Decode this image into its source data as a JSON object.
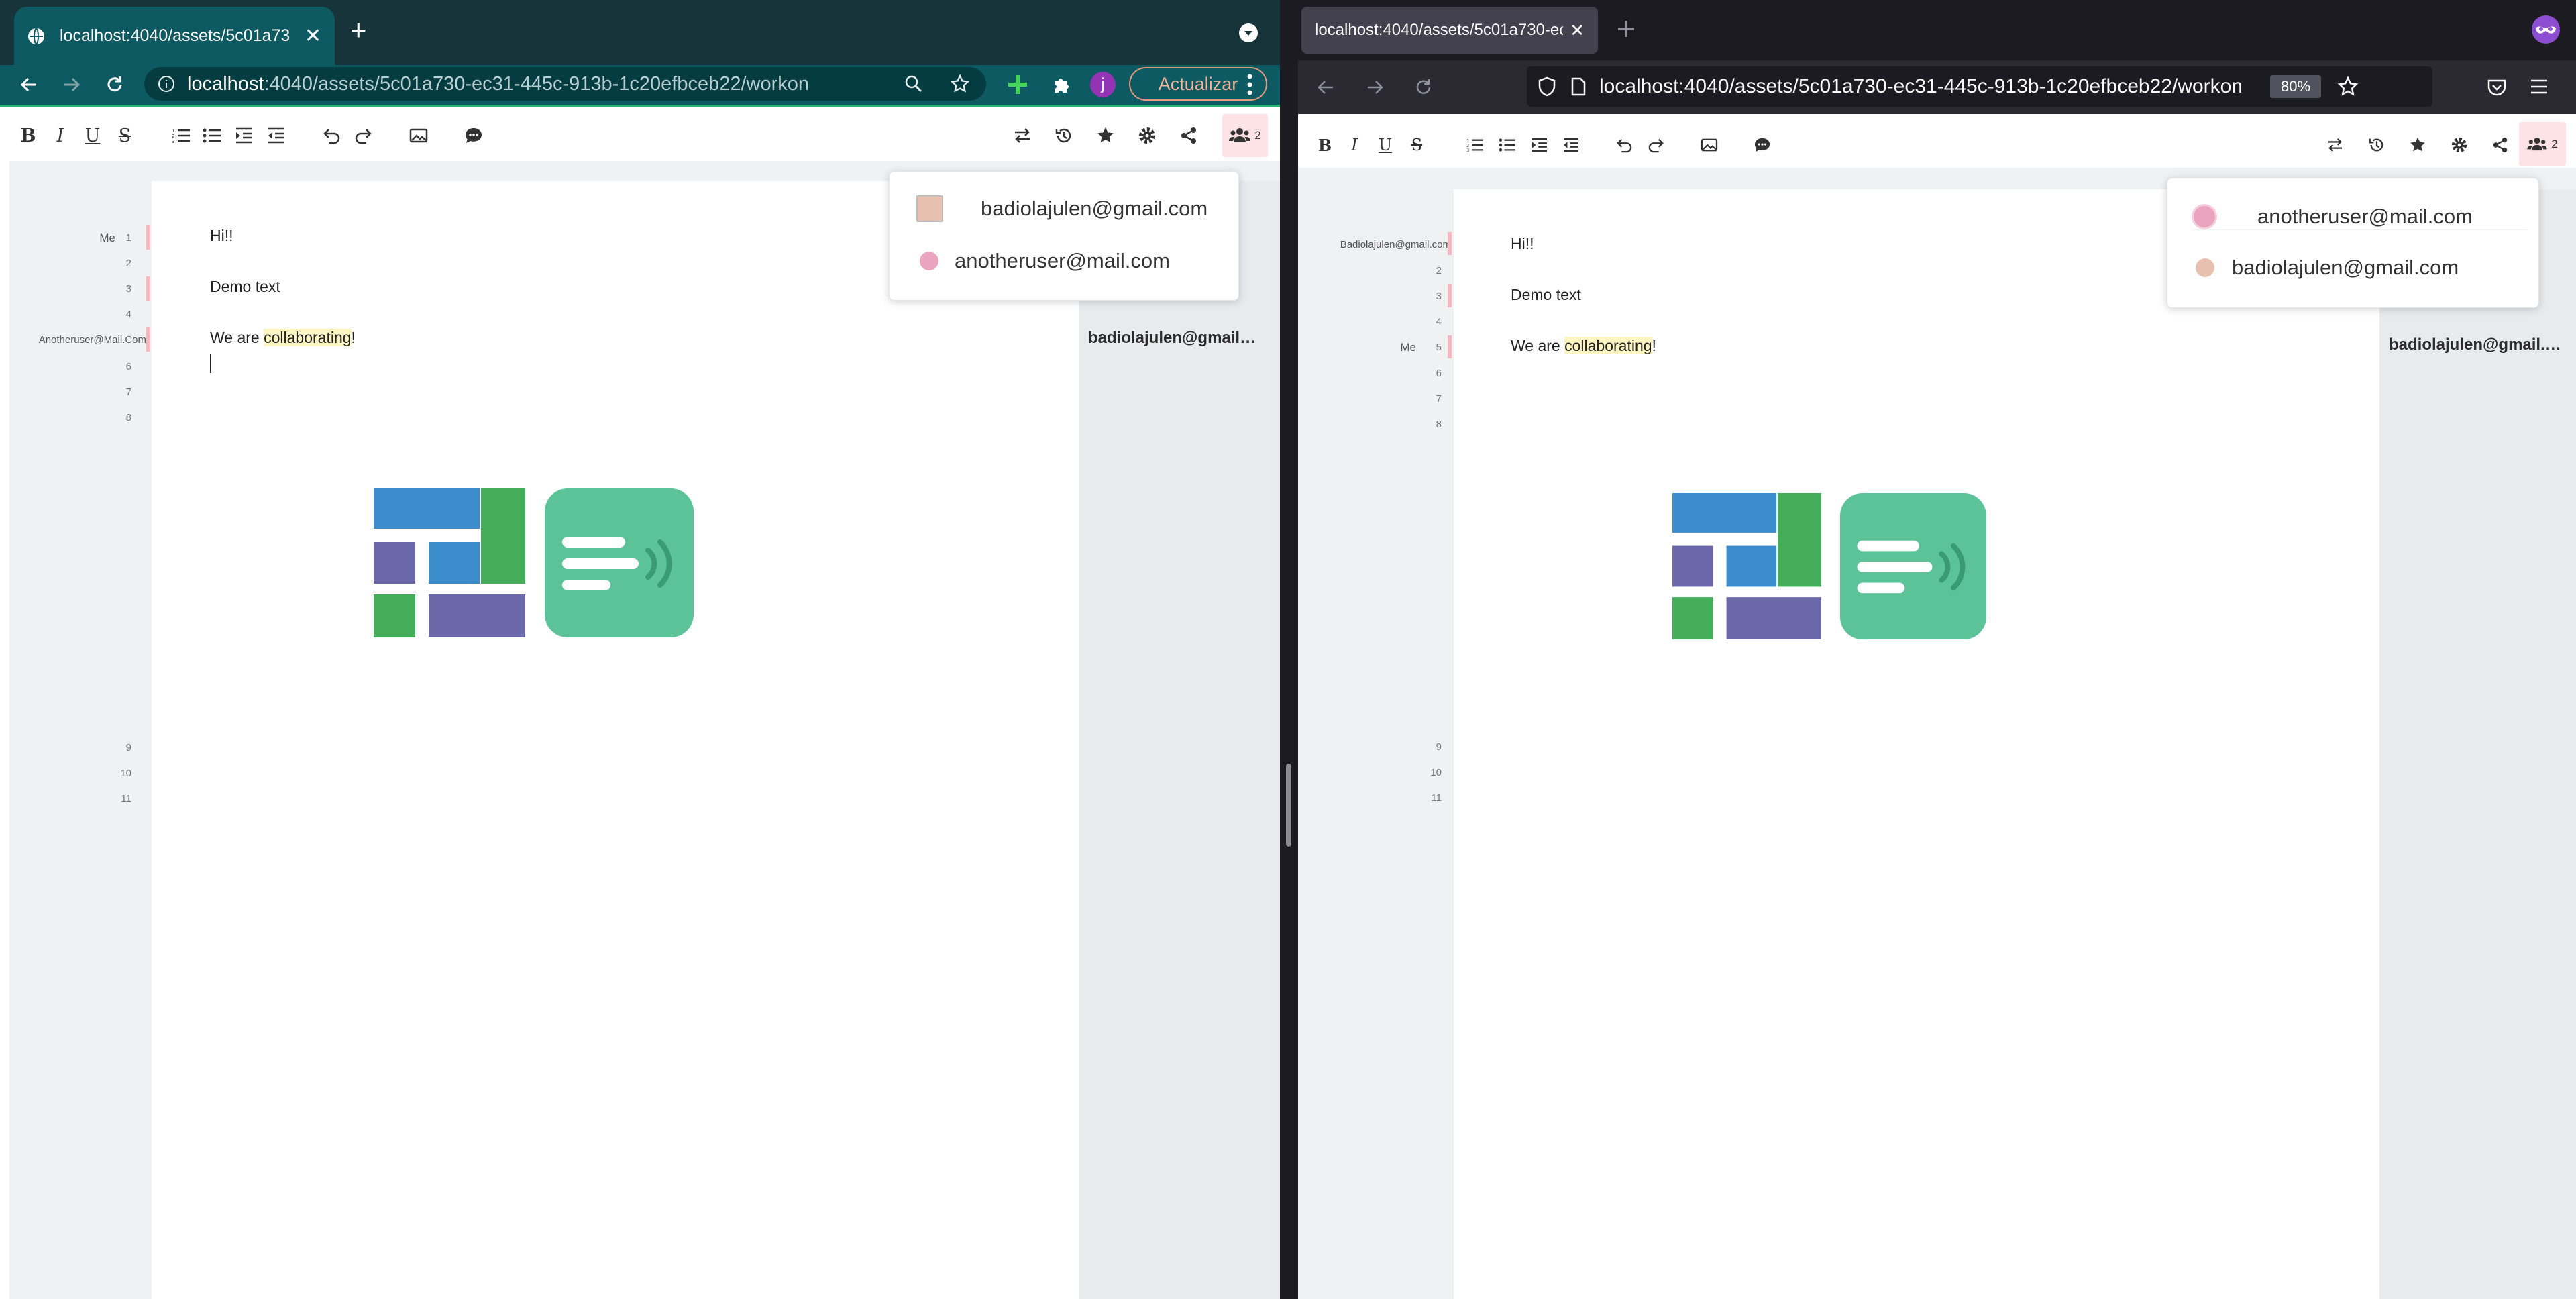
{
  "chrome": {
    "tab": {
      "title": "localhost:4040/assets/5c01a73",
      "new_tab_glyph": "+"
    },
    "url": {
      "host": "localhost",
      "path": ":4040/assets/5c01a730-ec31-445c-913b-1c20efbceb22/workon"
    },
    "profile_initial": "j",
    "update_label": "Actualizar"
  },
  "firefox": {
    "tab": {
      "title": "localhost:4040/assets/5c01a730-ec"
    },
    "url": "localhost:4040/assets/5c01a730-ec31-445c-913b-1c20efbceb22/workon",
    "zoom": "80%"
  },
  "editor": {
    "toolbar": {
      "bold": "B",
      "italic": "I",
      "underline": "U",
      "strike": "S",
      "collaborators_count": "2"
    },
    "lines": [
      {
        "n": "1",
        "text": "Hi!!"
      },
      {
        "n": "2",
        "text": ""
      },
      {
        "n": "3",
        "text": "Demo text"
      },
      {
        "n": "4",
        "text": ""
      },
      {
        "n": "5",
        "text_before": "We are ",
        "highlight": "collaborating",
        "text_after": "!"
      },
      {
        "n": "6",
        "text": ""
      },
      {
        "n": "7",
        "text": ""
      },
      {
        "n": "8",
        "text": ""
      },
      {
        "n": "9",
        "text": ""
      },
      {
        "n": "10",
        "text": ""
      },
      {
        "n": "11",
        "text": ""
      }
    ],
    "highlight_color": "#fdf5c2"
  },
  "left_view": {
    "gutter_me_label": "Me",
    "gutter_other_label": "Anotheruser@Mail.Com",
    "line_numbers_shown": [
      "1",
      "2",
      "3",
      "4",
      "5",
      "6",
      "7",
      "8",
      "9",
      "10",
      "11"
    ],
    "popup": [
      {
        "name": "badiolajulen@gmail.com",
        "color": "#e8c0b0"
      },
      {
        "name": "anotheruser@mail.com",
        "color": "#eaa4bd"
      }
    ],
    "side_author": "badiolajulen@gmail.com"
  },
  "right_view": {
    "gutter_other_label": "Badiolajulen@gmail.com",
    "gutter_me_label": "Me",
    "popup": [
      {
        "name": "anotheruser@mail.com",
        "color": "#eaa4bd"
      },
      {
        "name": "badiolajulen@gmail.com",
        "color": "#e8c0b0"
      }
    ],
    "side_author": "badiolajulen@gmail.com"
  },
  "colors": {
    "chrome_tabbar": "#17343a",
    "chrome_toolbar": "#0d5a62",
    "firefox_tabbar": "#1c1b22",
    "firefox_toolbar": "#2b2a33",
    "cursor_bar": "#f6b9c0",
    "logo_blue": "#3b8ccb",
    "logo_purple": "#6b68aa",
    "logo_green": "#44ad5a",
    "logo_teal": "#5cc398"
  }
}
